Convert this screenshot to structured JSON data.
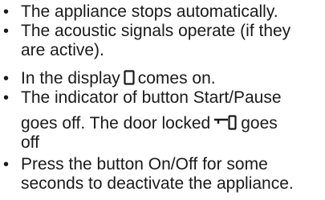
{
  "bullet_char": "•",
  "items": [
    {
      "lines": [
        "The appliance stops automatically."
      ]
    },
    {
      "lines": [
        "The acoustic signals operate (if they",
        "are active)."
      ]
    },
    {
      "pre": "In the display",
      "icon": "display-zero-icon",
      "post": "comes on."
    },
    {
      "line1": "The indicator of button Start/Pause",
      "line2_pre": "goes off. The door locked",
      "line2_icon": "door-locked-icon",
      "line2_post": "goes",
      "line3": "off"
    },
    {
      "lines": [
        "Press the button On/Off for some",
        "seconds to deactivate the appliance."
      ]
    }
  ]
}
